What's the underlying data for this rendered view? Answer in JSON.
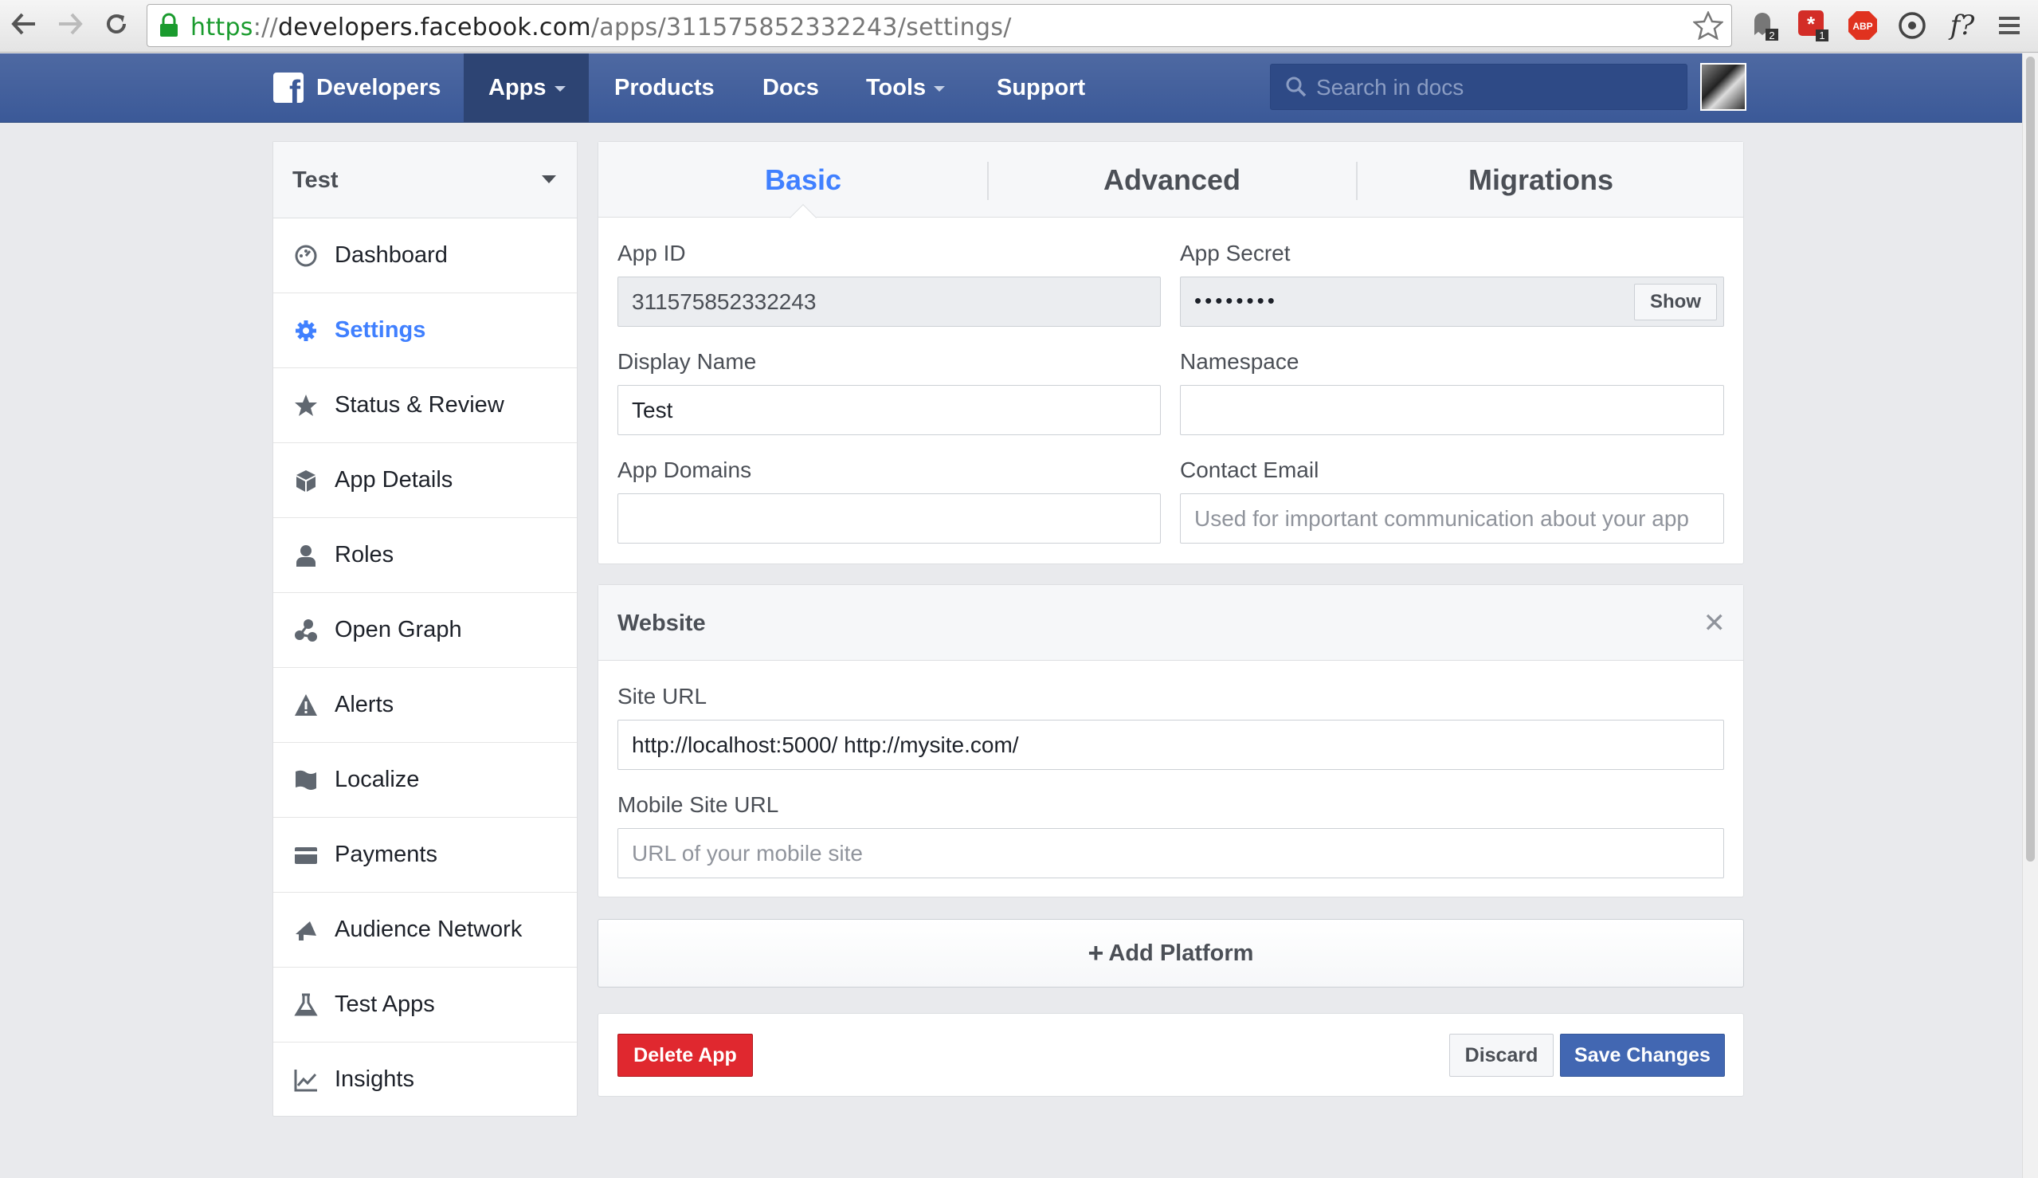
{
  "browser": {
    "url": {
      "scheme": "https",
      "separator": "://",
      "host": "developers.facebook.com",
      "path": "/apps/311575852332243/settings/"
    },
    "extension_badges": {
      "ghostery": "2",
      "lastpass": "1",
      "adblock": "ABP",
      "fquery": "f?"
    }
  },
  "topnav": {
    "brand": "Developers",
    "items": [
      {
        "label": "Apps",
        "dropdown": true,
        "active": true
      },
      {
        "label": "Products"
      },
      {
        "label": "Docs"
      },
      {
        "label": "Tools",
        "dropdown": true
      },
      {
        "label": "Support"
      }
    ],
    "search_placeholder": "Search in docs"
  },
  "sidebar": {
    "app_name": "Test",
    "items": [
      {
        "label": "Dashboard",
        "icon": "dashboard-icon"
      },
      {
        "label": "Settings",
        "icon": "gear-icon",
        "active": true
      },
      {
        "label": "Status & Review",
        "icon": "star-icon"
      },
      {
        "label": "App Details",
        "icon": "cube-icon"
      },
      {
        "label": "Roles",
        "icon": "person-icon"
      },
      {
        "label": "Open Graph",
        "icon": "graph-icon"
      },
      {
        "label": "Alerts",
        "icon": "warning-icon"
      },
      {
        "label": "Localize",
        "icon": "flag-icon"
      },
      {
        "label": "Payments",
        "icon": "credit-card-icon"
      },
      {
        "label": "Audience Network",
        "icon": "megaphone-icon"
      },
      {
        "label": "Test Apps",
        "icon": "flask-icon"
      },
      {
        "label": "Insights",
        "icon": "chart-icon"
      }
    ]
  },
  "tabs": [
    {
      "label": "Basic",
      "active": true
    },
    {
      "label": "Advanced"
    },
    {
      "label": "Migrations"
    }
  ],
  "basic": {
    "app_id_label": "App ID",
    "app_id_value": "311575852332243",
    "app_secret_label": "App Secret",
    "app_secret_value": "••••••••",
    "show_label": "Show",
    "display_name_label": "Display Name",
    "display_name_value": "Test",
    "namespace_label": "Namespace",
    "namespace_value": "",
    "app_domains_label": "App Domains",
    "app_domains_value": "",
    "contact_email_label": "Contact Email",
    "contact_email_placeholder": "Used for important communication about your app"
  },
  "website": {
    "title": "Website",
    "site_url_label": "Site URL",
    "site_url_value": "http://localhost:5000/ http://mysite.com/",
    "mobile_url_label": "Mobile Site URL",
    "mobile_url_placeholder": "URL of your mobile site"
  },
  "add_platform_label": "Add Platform",
  "actions": {
    "delete_label": "Delete App",
    "discard_label": "Discard",
    "save_label": "Save Changes"
  },
  "colors": {
    "fb_blue": "#3b5998",
    "active_link": "#4080ff",
    "delete_red": "#e0282f",
    "save_blue": "#4267b2"
  }
}
